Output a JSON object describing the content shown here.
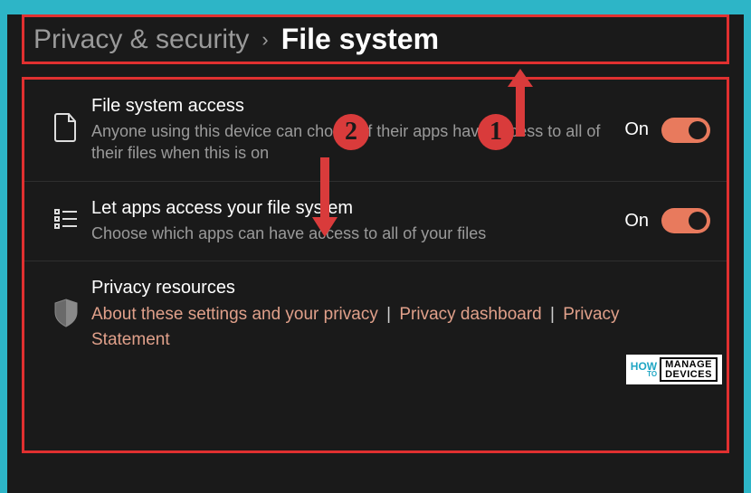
{
  "breadcrumb": {
    "parent": "Privacy & security",
    "separator": "›",
    "current": "File system"
  },
  "settings": [
    {
      "icon": "file-icon",
      "title": "File system access",
      "desc": "Anyone using this device can choose if their apps have access to all of their files when this is on",
      "stateLabel": "On"
    },
    {
      "icon": "list-icon",
      "title": "Let apps access your file system",
      "desc": "Choose which apps can have access to all of your files",
      "stateLabel": "On"
    }
  ],
  "privacyResources": {
    "title": "Privacy resources",
    "link1": "About these settings and your privacy",
    "link2": "Privacy dashboard",
    "link3": "Privacy Statement"
  },
  "annotations": {
    "badge1": "1",
    "badge2": "2"
  },
  "watermark": {
    "how": "HOW",
    "to": "TO",
    "line1": "MANAGE",
    "line2": "DEVICES"
  },
  "colors": {
    "accent": "#e87a5d",
    "annotation": "#d93b3b",
    "page_bg": "#2db5c7"
  }
}
